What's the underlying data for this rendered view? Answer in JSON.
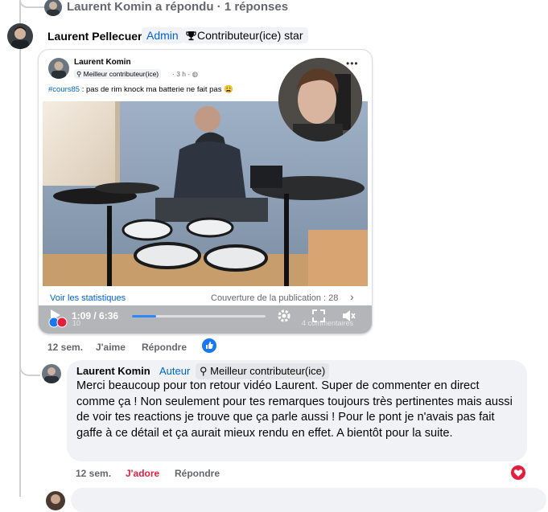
{
  "top_reply": {
    "text": "Laurent Komin a répondu · 1 réponses"
  },
  "main_comment": {
    "author": "Laurent Pellecuer",
    "role_badge": "Admin",
    "star_badge": "Contributeur(ice) star",
    "embedded_post": {
      "author": "Laurent Komin",
      "badge": "Meilleur contributeur(ice)",
      "time": "3 h",
      "hashtag": "#cours85",
      "caption": " : pas de rim knock ma batterie ne fait pas 😩",
      "stats_link": "Voir les statistiques",
      "reach": "Couverture de la publication : 28",
      "video_time": "1:09 / 6:36",
      "video_progress": 0.18,
      "reactions_count": "10",
      "comments_count": "4 commentaires"
    },
    "time": "12 sem.",
    "like_label": "J'aime",
    "reply_label": "Répondre"
  },
  "reply_comment": {
    "author": "Laurent Komin",
    "role_badge": "Auteur",
    "star_badge": "Meilleur contributeur(ice)",
    "text": "Merci beaucoup pour ton retour vidéo Laurent. Super de commenter en direct comme ça ! Non seulement pour tes remarques toujours très pertinentes mais aussi de voir tes reactions je trouve que ça parle aussi ! Pour le pont je n'avais pas fait gaffe à ce détail et ça aurait mieux rendu en effet. A bientôt pour la suite.",
    "time": "12 sem.",
    "reaction_label": "J'adore",
    "reply_label": "Répondre"
  },
  "colors": {
    "link_blue": "#0064d1",
    "love_red": "#e41e3f",
    "meta_gray": "#65676b",
    "bubble_bg": "#f0f2f5"
  }
}
